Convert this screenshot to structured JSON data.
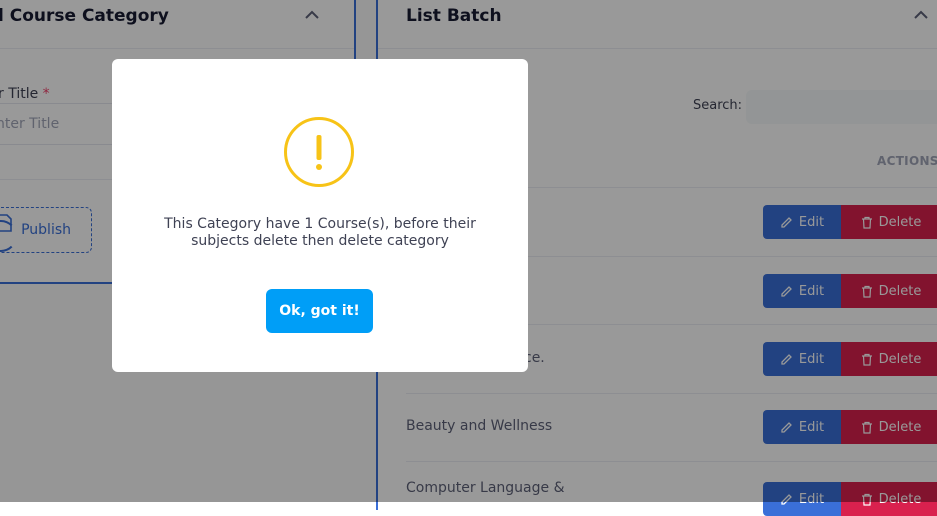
{
  "left_card": {
    "title": "l Course Category",
    "field_label": "r Title",
    "required_mark": "*",
    "field_placeholder": "nter Title",
    "publish_label": "Publish"
  },
  "right_card": {
    "title": "List Batch",
    "search_label": "Search:",
    "actions_header": "ACTIONS",
    "rows": [
      {
        "name": ""
      },
      {
        "name": ""
      },
      {
        "name": "ce."
      },
      {
        "name": "Beauty and Wellness"
      },
      {
        "name": "Computer Language &"
      }
    ],
    "edit_label": "Edit",
    "delete_label": "Delete"
  },
  "modal": {
    "icon": "exclamation-circle-icon",
    "message": "This Category have 1 Course(s), before their subjects delete then delete category",
    "ok_label": "Ok, got it!"
  },
  "colors": {
    "primary": "#3a6fd8",
    "danger": "#d9214e",
    "warning": "#f7c317",
    "info": "#009ef7"
  }
}
